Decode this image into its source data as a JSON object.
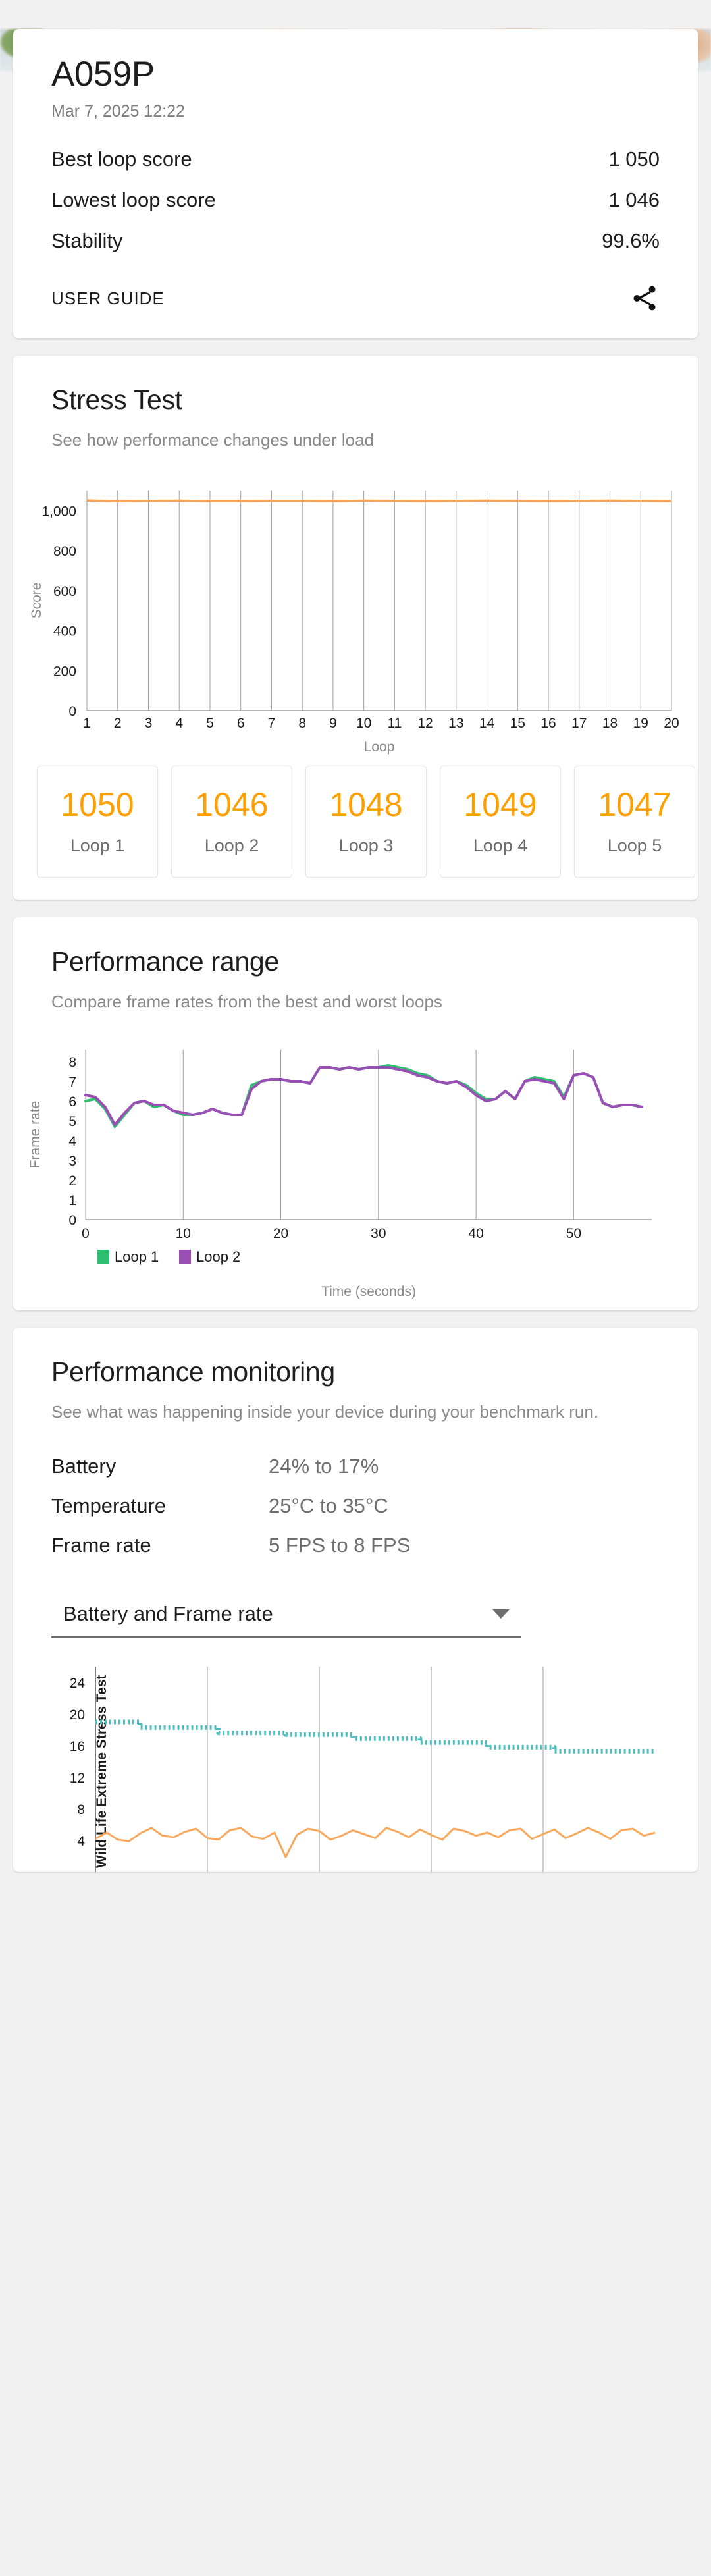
{
  "summary": {
    "device_title": "A059P",
    "date": "Mar 7, 2025 12:22",
    "rows": [
      {
        "label": "Best loop score",
        "value": "1 050"
      },
      {
        "label": "Lowest loop score",
        "value": "1 046"
      },
      {
        "label": "Stability",
        "value": "99.6%"
      }
    ],
    "user_guide_label": "USER GUIDE",
    "share_icon": "share-icon"
  },
  "stress_test": {
    "title": "Stress Test",
    "subtitle": "See how performance changes under load",
    "loop_cards": [
      {
        "score": "1050",
        "name": "Loop 1"
      },
      {
        "score": "1046",
        "name": "Loop 2"
      },
      {
        "score": "1048",
        "name": "Loop 3"
      },
      {
        "score": "1049",
        "name": "Loop 4"
      },
      {
        "score": "1047",
        "name": "Loop 5"
      }
    ]
  },
  "performance_range": {
    "title": "Performance range",
    "subtitle": "Compare frame rates from the best and worst loops"
  },
  "performance_monitoring": {
    "title": "Performance monitoring",
    "subtitle": "See what was happening inside your device during your benchmark run.",
    "rows": [
      {
        "label": "Battery",
        "value": "24% to 17%"
      },
      {
        "label": "Temperature",
        "value": "25°C to 35°C"
      },
      {
        "label": "Frame rate",
        "value": "5 FPS to 8 FPS"
      }
    ],
    "selector": {
      "value": "Battery and Frame rate",
      "icon": "chevron-down-icon"
    }
  },
  "colors": {
    "score_line": "#F5A55B",
    "loop_score": "#FFA000",
    "loop1": "#2EBF70",
    "loop2": "#9A4FB5",
    "battery_line": "#4DBDBD",
    "framerate_line": "#F7A85C",
    "grid": "#9e9e9e"
  },
  "chart_data": [
    {
      "type": "line",
      "id": "stress-test-chart",
      "title": "",
      "xlabel": "Loop",
      "ylabel": "Score",
      "xlim": [
        1,
        20
      ],
      "ylim": [
        0,
        1100
      ],
      "yticks": [
        0,
        200,
        400,
        600,
        800,
        1000
      ],
      "ytick_labels": [
        "0",
        "200",
        "400",
        "600",
        "800",
        "1,000"
      ],
      "xticks": [
        1,
        2,
        3,
        4,
        5,
        6,
        7,
        8,
        9,
        10,
        11,
        12,
        13,
        14,
        15,
        16,
        17,
        18,
        19,
        20
      ],
      "grid": true,
      "series": [
        {
          "name": "Score",
          "color": "#F5A55B",
          "x": [
            1,
            2,
            3,
            4,
            5,
            6,
            7,
            8,
            9,
            10,
            11,
            12,
            13,
            14,
            15,
            16,
            17,
            18,
            19,
            20
          ],
          "values": [
            1050,
            1046,
            1048,
            1049,
            1047,
            1047,
            1048,
            1048,
            1047,
            1049,
            1048,
            1047,
            1048,
            1049,
            1048,
            1047,
            1048,
            1049,
            1048,
            1047
          ]
        }
      ]
    },
    {
      "type": "line",
      "id": "performance-range-chart",
      "title": "",
      "xlabel": "Time (seconds)",
      "ylabel": "Frame rate",
      "xlim": [
        0,
        58
      ],
      "ylim": [
        0,
        8.6
      ],
      "yticks": [
        0,
        1,
        2,
        3,
        4,
        5,
        6,
        7,
        8
      ],
      "xticks": [
        0,
        10,
        20,
        30,
        40,
        50
      ],
      "grid": true,
      "legend_position": "bottom-left",
      "series": [
        {
          "name": "Loop 1",
          "color": "#2EBF70",
          "x": [
            0,
            1,
            2,
            3,
            4,
            5,
            6,
            7,
            8,
            9,
            10,
            11,
            12,
            13,
            14,
            15,
            16,
            17,
            18,
            19,
            20,
            21,
            22,
            23,
            24,
            25,
            26,
            27,
            28,
            29,
            30,
            31,
            32,
            33,
            34,
            35,
            36,
            37,
            38,
            39,
            40,
            41,
            42,
            43,
            44,
            45,
            46,
            47,
            48,
            49,
            50,
            51,
            52,
            53,
            54,
            55,
            56,
            57
          ],
          "values": [
            6.0,
            6.1,
            5.6,
            4.7,
            5.3,
            5.9,
            6.0,
            5.7,
            5.8,
            5.5,
            5.3,
            5.3,
            5.4,
            5.6,
            5.4,
            5.3,
            5.3,
            6.8,
            7.0,
            7.1,
            7.1,
            7.0,
            7.0,
            6.9,
            7.7,
            7.7,
            7.6,
            7.7,
            7.6,
            7.7,
            7.7,
            7.8,
            7.7,
            7.6,
            7.4,
            7.3,
            7.0,
            6.9,
            7.0,
            6.8,
            6.4,
            6.1,
            6.1,
            6.5,
            6.1,
            7.0,
            7.2,
            7.1,
            7.0,
            6.2,
            7.3,
            7.4,
            7.2,
            5.9,
            5.7,
            5.8,
            5.8,
            5.7
          ]
        },
        {
          "name": "Loop 2",
          "color": "#9A4FB5",
          "x": [
            0,
            1,
            2,
            3,
            4,
            5,
            6,
            7,
            8,
            9,
            10,
            11,
            12,
            13,
            14,
            15,
            16,
            17,
            18,
            19,
            20,
            21,
            22,
            23,
            24,
            25,
            26,
            27,
            28,
            29,
            30,
            31,
            32,
            33,
            34,
            35,
            36,
            37,
            38,
            39,
            40,
            41,
            42,
            43,
            44,
            45,
            46,
            47,
            48,
            49,
            50,
            51,
            52,
            53,
            54,
            55,
            56,
            57
          ],
          "values": [
            6.3,
            6.2,
            5.7,
            4.8,
            5.4,
            5.9,
            6.0,
            5.8,
            5.8,
            5.5,
            5.4,
            5.3,
            5.4,
            5.6,
            5.4,
            5.3,
            5.3,
            6.6,
            7.0,
            7.1,
            7.1,
            7.0,
            7.0,
            6.9,
            7.7,
            7.7,
            7.6,
            7.7,
            7.6,
            7.7,
            7.7,
            7.7,
            7.6,
            7.5,
            7.3,
            7.2,
            7.0,
            6.9,
            7.0,
            6.7,
            6.3,
            6.0,
            6.1,
            6.5,
            6.1,
            7.0,
            7.1,
            7.0,
            6.9,
            6.1,
            7.3,
            7.4,
            7.2,
            5.9,
            5.7,
            5.8,
            5.8,
            5.7
          ]
        }
      ]
    },
    {
      "type": "line",
      "id": "monitoring-chart",
      "title": "Wild Life Extreme Stress Test",
      "xlabel": "",
      "ylabel": "",
      "xlim": [
        0,
        100
      ],
      "ylim": [
        0,
        26
      ],
      "yticks": [
        4,
        8,
        12,
        16,
        20,
        24
      ],
      "grid": true,
      "series": [
        {
          "name": "Battery",
          "color": "#4DBDBD",
          "style": "dotted-step",
          "x": [
            0,
            8,
            8,
            22,
            22,
            34,
            34,
            46,
            46,
            58,
            58,
            70,
            70,
            82,
            82,
            100
          ],
          "values": [
            19,
            19,
            18.3,
            18.3,
            17.6,
            17.6,
            17.4,
            17.4,
            16.9,
            16.9,
            16.4,
            16.4,
            15.8,
            15.8,
            15.3,
            15.3
          ]
        },
        {
          "name": "Frame rate",
          "color": "#F7A85C",
          "style": "jagged",
          "x": [
            0,
            2,
            4,
            6,
            8,
            10,
            12,
            14,
            16,
            18,
            20,
            22,
            24,
            26,
            28,
            30,
            32,
            34,
            36,
            38,
            40,
            42,
            44,
            46,
            48,
            50,
            52,
            54,
            56,
            58,
            60,
            62,
            64,
            66,
            68,
            70,
            72,
            74,
            76,
            78,
            80,
            82,
            84,
            86,
            88,
            90,
            92,
            94,
            96,
            98,
            100
          ],
          "values": [
            4.2,
            5.0,
            4.1,
            3.9,
            4.9,
            5.6,
            4.6,
            4.4,
            5.1,
            5.5,
            4.3,
            4.1,
            5.3,
            5.6,
            4.5,
            4.2,
            5.0,
            1.9,
            4.7,
            5.5,
            5.2,
            4.1,
            4.6,
            5.3,
            4.8,
            4.3,
            5.6,
            5.1,
            4.4,
            5.4,
            4.7,
            4.1,
            5.5,
            5.2,
            4.6,
            5.0,
            4.4,
            5.3,
            5.5,
            4.2,
            4.8,
            5.4,
            4.3,
            4.9,
            5.6,
            5.0,
            4.2,
            5.3,
            5.5,
            4.6,
            5.0
          ]
        }
      ]
    }
  ]
}
